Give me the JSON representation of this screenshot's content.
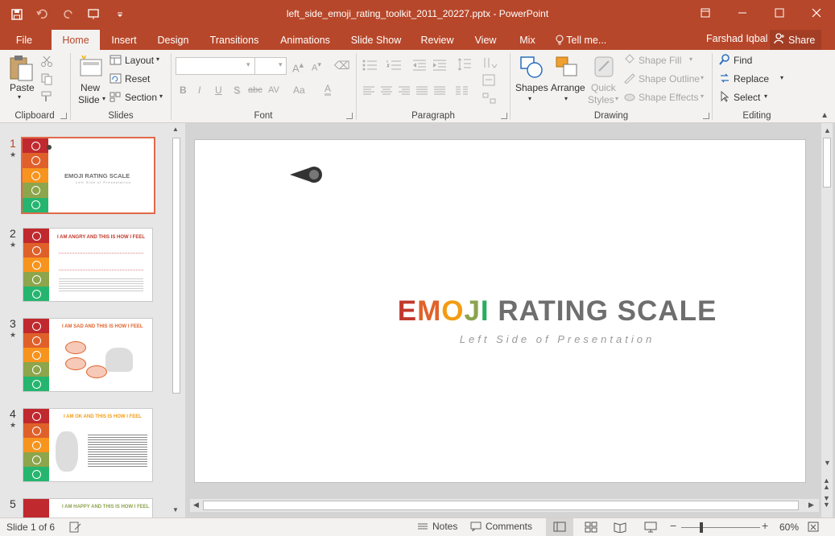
{
  "window": {
    "title": "left_side_emoji_rating_toolkit_2011_20227.pptx - PowerPoint",
    "accent": "#b7472a"
  },
  "tabs": [
    "File",
    "Home",
    "Insert",
    "Design",
    "Transitions",
    "Animations",
    "Slide Show",
    "Review",
    "View",
    "Mix"
  ],
  "tell_me": "Tell me...",
  "user": "Farshad Iqbal",
  "share": "Share",
  "ribbon": {
    "clipboard": {
      "label": "Clipboard",
      "paste": "Paste"
    },
    "slides": {
      "label": "Slides",
      "new_slide_1": "New",
      "new_slide_2": "Slide",
      "layout": "Layout",
      "reset": "Reset",
      "section": "Section"
    },
    "font": {
      "label": "Font",
      "bold": "B",
      "italic": "I",
      "underline": "U",
      "shadow": "S",
      "strike": "abc",
      "spacing": "AV",
      "case": "Aa",
      "color": "A"
    },
    "paragraph": {
      "label": "Paragraph"
    },
    "drawing": {
      "label": "Drawing",
      "shapes": "Shapes",
      "arrange": "Arrange",
      "quick_styles_1": "Quick",
      "quick_styles_2": "Styles",
      "shape_fill": "Shape Fill",
      "shape_outline": "Shape Outline",
      "shape_effects": "Shape Effects"
    },
    "editing": {
      "label": "Editing",
      "find": "Find",
      "replace": "Replace",
      "select": "Select"
    }
  },
  "thumbnails": [
    {
      "num": "1",
      "title": "EMOJI RATING SCALE",
      "subtitle": "Left Side of Presentation",
      "color": "#c0392b"
    },
    {
      "num": "2",
      "title": "I AM ANGRY AND THIS IS HOW I FEEL",
      "color": "#c0392b"
    },
    {
      "num": "3",
      "title": "I AM SAD AND THIS IS HOW I FEEL",
      "color": "#e0622a"
    },
    {
      "num": "4",
      "title": "I AM OK AND THIS IS HOW I FEEL",
      "color": "#f39c12"
    },
    {
      "num": "5",
      "title": "I AM HAPPY AND THIS IS HOW I FEEL",
      "color": "#8ca34e"
    }
  ],
  "slide": {
    "title_letters": [
      {
        "ch": "E",
        "color": "#c0392b"
      },
      {
        "ch": "M",
        "color": "#e0622a"
      },
      {
        "ch": "O",
        "color": "#f39c12"
      },
      {
        "ch": "J",
        "color": "#8ca34e"
      },
      {
        "ch": "I",
        "color": "#27ae60"
      }
    ],
    "title_rest": "RATING SCALE",
    "title_rest_color": "#6e6e6e",
    "subtitle": "Left Side of Presentation",
    "bands": [
      {
        "mood": "angry",
        "color": "#c0292e"
      },
      {
        "mood": "sad",
        "color": "#e0602a"
      },
      {
        "mood": "neutral",
        "color": "#f7941d"
      },
      {
        "mood": "smile",
        "color": "#8da54b"
      },
      {
        "mood": "happy",
        "color": "#26b56f"
      }
    ]
  },
  "status": {
    "slide_of": "Slide 1 of 6",
    "notes": "Notes",
    "comments": "Comments",
    "zoom": "60%"
  }
}
